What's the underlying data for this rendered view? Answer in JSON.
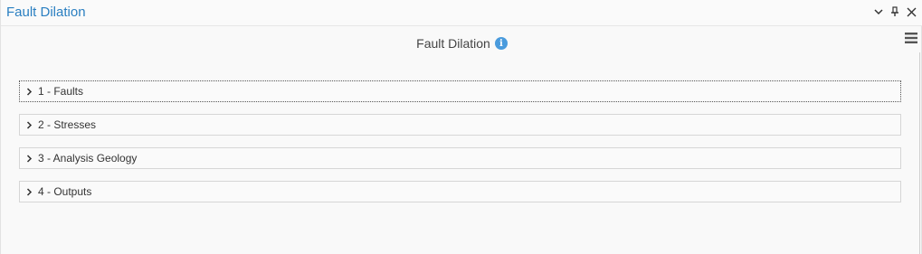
{
  "pane": {
    "title": "Fault Dilation",
    "controls": {
      "dropdown_icon": "chevron-down-icon",
      "pin_icon": "pin-icon",
      "close_icon": "close-icon"
    },
    "menu_icon": "hamburger-icon"
  },
  "tool": {
    "title": "Fault Dilation",
    "info_icon": "info-icon"
  },
  "groups": [
    {
      "label": "1 - Faults",
      "expanded": false,
      "focused": true
    },
    {
      "label": "2 - Stresses",
      "expanded": false,
      "focused": false
    },
    {
      "label": "3 - Analysis Geology",
      "expanded": false,
      "focused": false
    },
    {
      "label": "4 - Outputs",
      "expanded": false,
      "focused": false
    }
  ],
  "colors": {
    "title_blue": "#2a7fc1",
    "info_blue": "#4a9bdd"
  }
}
